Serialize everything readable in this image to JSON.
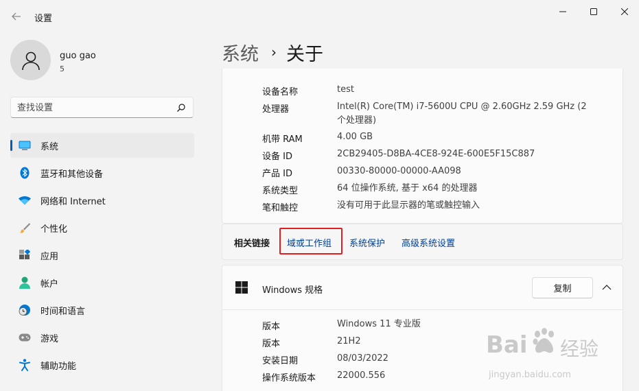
{
  "window": {
    "title": "设置"
  },
  "profile": {
    "name": "guo gao",
    "sub": "5"
  },
  "search": {
    "placeholder": "查找设置"
  },
  "sidebar": {
    "items": [
      {
        "label": "系统",
        "icon": "monitor-icon",
        "active": true
      },
      {
        "label": "蓝牙和其他设备",
        "icon": "bluetooth-icon"
      },
      {
        "label": "网络和 Internet",
        "icon": "wifi-icon"
      },
      {
        "label": "个性化",
        "icon": "brush-icon"
      },
      {
        "label": "应用",
        "icon": "apps-icon"
      },
      {
        "label": "帐户",
        "icon": "person-icon"
      },
      {
        "label": "时间和语言",
        "icon": "globe-clock-icon"
      },
      {
        "label": "游戏",
        "icon": "gamepad-icon"
      },
      {
        "label": "辅助功能",
        "icon": "accessibility-icon"
      }
    ]
  },
  "breadcrumb": {
    "parent": "系统",
    "separator": "›",
    "current": "关于"
  },
  "device_specs": [
    {
      "label": "设备名称",
      "value": "test"
    },
    {
      "label": "处理器",
      "value": "Intel(R) Core(TM) i7-5600U CPU @ 2.60GHz   2.59 GHz  (2 个处理器)"
    },
    {
      "label": "机带 RAM",
      "value": "4.00 GB"
    },
    {
      "label": "设备 ID",
      "value": "2CB29405-D8BA-4CE8-924E-600E5F15C887"
    },
    {
      "label": "产品 ID",
      "value": "00330-80000-00000-AA098"
    },
    {
      "label": "系统类型",
      "value": "64 位操作系统, 基于 x64 的处理器"
    },
    {
      "label": "笔和触控",
      "value": "没有可用于此显示器的笔或触控输入"
    }
  ],
  "related_links": {
    "label": "相关链接",
    "links": [
      "域或工作组",
      "系统保护",
      "高级系统设置"
    ]
  },
  "windows_spec": {
    "title": "Windows 规格",
    "copy_label": "复制",
    "rows": [
      {
        "label": "版本",
        "value": "Windows 11 专业版"
      },
      {
        "label": "版本",
        "value": "21H2"
      },
      {
        "label": "安装日期",
        "value": "08/03/2022"
      },
      {
        "label": "操作系统版本",
        "value": "22000.556"
      }
    ]
  },
  "watermark": {
    "brand": "Bai",
    "brand_cn": "经验",
    "url": "jingyan.baidu.com"
  },
  "colors": {
    "accent": "#005fb8",
    "link": "#003e92",
    "highlight": "#e02020"
  }
}
